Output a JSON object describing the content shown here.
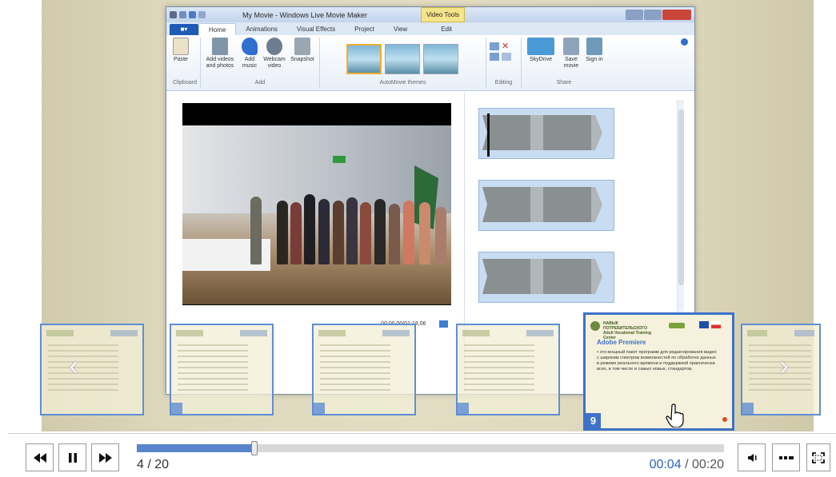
{
  "movie_maker": {
    "window_title": "My Movie - Windows Live Movie Maker",
    "video_tools_tab": "Video Tools",
    "menu_tabs": [
      "Home",
      "Animations",
      "Visual Effects",
      "Project",
      "View",
      "Edit"
    ],
    "ribbon": {
      "paste": "Paste",
      "add_videos": "Add videos and photos",
      "add_music": "Add music",
      "webcam": "Webcam video",
      "snapshot": "Snapshot",
      "skydrive": "SkyDrive",
      "save_movie": "Save movie",
      "sign_in": "Sign in",
      "groups": [
        "Clipboard",
        "Add",
        "AutoMovie themes",
        "Editing",
        "Share"
      ]
    },
    "preview_time": "00:00,00/01:18,06"
  },
  "slides": {
    "active": {
      "number": "9",
      "title": "Adobe Premiere",
      "header_text": "НАВЫК ПОТРЕБИТЕЛЬСКОГО Adult Vocational Training Center",
      "body": "это мощный пакет программ для редактирования видео с широким спектром возможностей по обработке данных в режиме реального времени и поддержкой практически всех, в том числе и самых новых, стандартов."
    },
    "thumb_numbers": [
      "",
      "",
      "",
      "",
      ""
    ]
  },
  "player": {
    "current_slide": "4",
    "total_slides": "20",
    "current_time": "00:04",
    "total_time": "00:20",
    "progress": 0.2,
    "colors": {
      "accent": "#5a84cc",
      "time_current": "#2a64c0"
    },
    "icons": [
      "rewind-icon",
      "pause-icon",
      "fast-forward-icon",
      "volume-icon",
      "outline-icon",
      "fullscreen-icon"
    ]
  }
}
